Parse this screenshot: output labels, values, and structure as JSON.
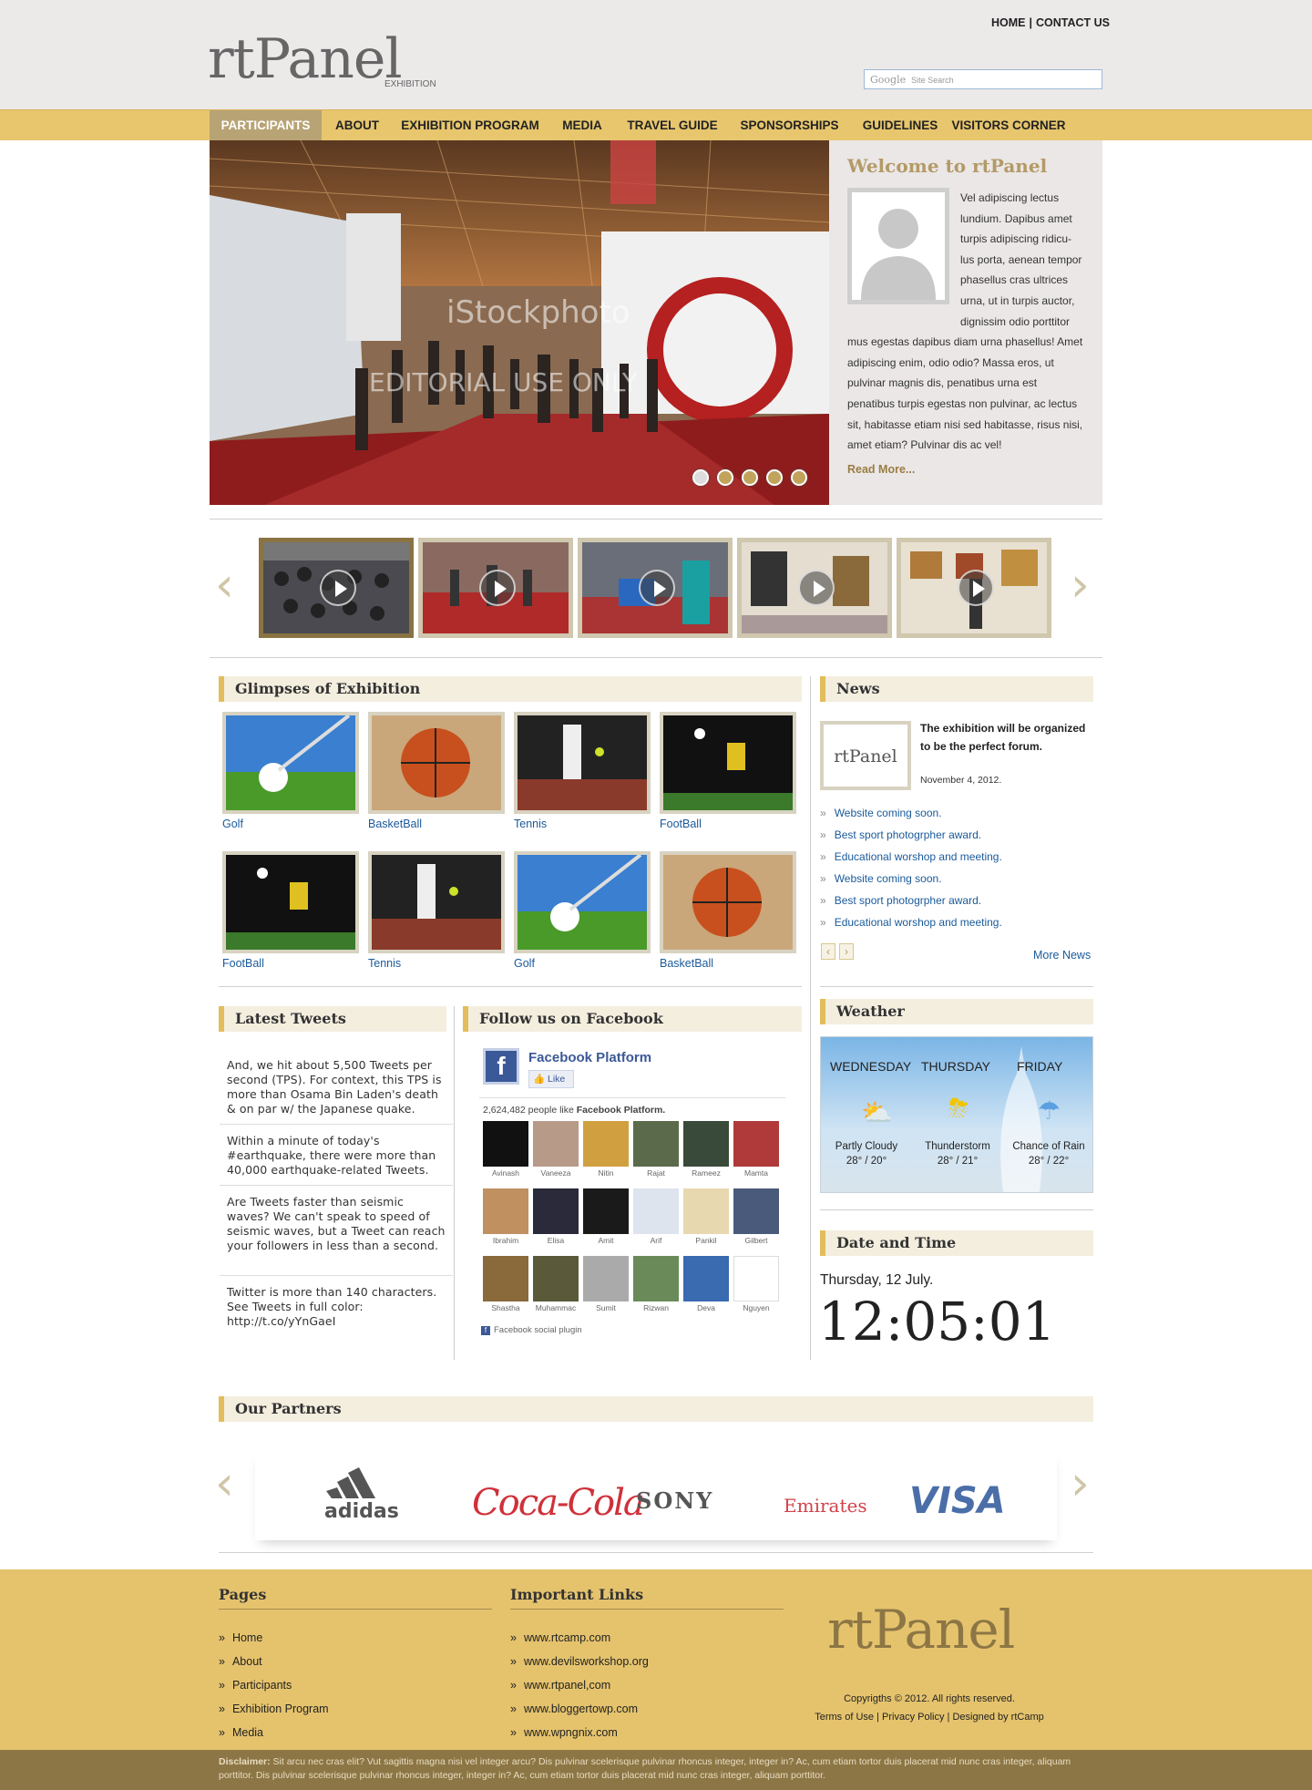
{
  "header": {
    "top_links": [
      "HOME",
      "CONTACT US"
    ],
    "logo": "rtPanel",
    "logo_sub": "EXHIBITION",
    "search_brand": "Google",
    "search_placeholder": "Site Search"
  },
  "nav": {
    "items": [
      "PARTICIPANTS",
      "ABOUT",
      "EXHIBITION PROGRAM",
      "MEDIA",
      "TRAVEL GUIDE",
      "SPONSORSHIPS",
      "GUIDELINES",
      "VISITORS CORNER"
    ],
    "active": "PARTICIPANTS"
  },
  "slider": {
    "watermark": "iStockphoto",
    "watermark2": "EDITORIAL USE ONLY",
    "dots": 5
  },
  "welcome": {
    "title": "Welcome to rtPanel",
    "text": "Vel adipiscing lectus lundium. Dapibus amet turpis adipiscing ridicu-lus porta, aenean tempor phasellus cras ultrices urna, ut in turpis auctor, dignissim odio porttitor mus egestas dapibus diam urna phasellus! Amet adipiscing enim, odio odio? Massa eros, ut pulvinar magnis dis, penatibus urna est penatibus turpis egestas non pulvinar, ac lectus sit, habitasse etiam nisi sed habitasse, risus nisi, amet etiam? Pulvinar dis ac vel!",
    "read_more": "Read More..."
  },
  "glimpses": {
    "title": "Glimpses of Exhibition",
    "items": [
      "Golf",
      "BasketBall",
      "Tennis",
      "FootBall",
      "FootBall",
      "Tennis",
      "Golf",
      "BasketBall"
    ]
  },
  "news": {
    "title": "News",
    "featured_logo": "rtPanel",
    "featured_title": "The exhibition will be organized to be the perfect forum.",
    "featured_date": "November 4, 2012.",
    "items": [
      "Website coming soon.",
      "Best sport photogrpher award.",
      "Educational worshop and meeting.",
      "Website coming soon.",
      "Best sport photogrpher award.",
      "Educational worshop and meeting."
    ],
    "more": "More News"
  },
  "tweets": {
    "title": "Latest Tweets",
    "items": [
      "And, we hit about 5,500 Tweets per second (TPS). For context, this TPS is more than Osama Bin Laden's death & on par w/ the Japanese quake.",
      "Within a minute of today's #earthquake, there were more than 40,000 earthquake-related Tweets.",
      "Are Tweets faster than seismic waves? We can't speak to speed of seismic waves, but a Tweet can reach your followers in less than a second.",
      "Twitter is more than 140 characters. See Tweets in full color: http://t.co/yYnGaeI"
    ]
  },
  "facebook": {
    "title": "Follow us on Facebook",
    "page_name": "Facebook Platform",
    "like": "Like",
    "count_text": "2,624,482 people like",
    "count_page": "Facebook Platform.",
    "people": [
      "Avinash",
      "Vaneeza",
      "Nitin",
      "Rajat",
      "Rameez",
      "Mamta",
      "Ibrahim",
      "Elisa",
      "Amit",
      "Arif",
      "Pankil",
      "Gilbert",
      "Shastha",
      "Muhammac",
      "Sumit",
      "Rizwan",
      "Deva",
      "Nguyen"
    ],
    "plugin": "Facebook social plugin"
  },
  "weather": {
    "title": "Weather",
    "days": [
      {
        "day": "WEDNESDAY",
        "cond": "Partly Cloudy",
        "temp": "28° / 20°"
      },
      {
        "day": "THURSDAY",
        "cond": "Thunderstorm",
        "temp": "28° / 21°"
      },
      {
        "day": "FRIDAY",
        "cond": "Chance of Rain",
        "temp": "28° / 22°"
      }
    ]
  },
  "datetime": {
    "title": "Date and Time",
    "date": "Thursday, 12 July.",
    "time": "12:05:01"
  },
  "partners": {
    "title": "Our Partners",
    "logos": [
      "adidas",
      "Coca-Cola",
      "SONY",
      "Emirates",
      "VISA"
    ]
  },
  "footer": {
    "pages_title": "Pages",
    "pages": [
      "Home",
      "About",
      "Participants",
      "Exhibition Program",
      "Media"
    ],
    "links_title": "Important Links",
    "links": [
      "www.rtcamp.com",
      "www.devilsworkshop.org",
      "www.rtpanel,com",
      "www.bloggertowp.com",
      "www.wpngnix.com"
    ],
    "logo": "rtPanel",
    "copyright": "Copyrigths © 2012. All rights reserved.",
    "terms": "Terms of Use",
    "privacy": "Privacy Policy",
    "designed": "Designed by rtCamp",
    "disclaimer_label": "Disclaimer:",
    "disclaimer": "Sit arcu nec cras elit? Vut sagittis magna nisi vel integer arcu? Dis pulvinar scelerisque pulvinar rhoncus integer, integer in? Ac, cum etiam tortor duis placerat mid nunc cras integer, aliquam porttitor. Dis pulvinar scelerisque pulvinar rhoncus integer, integer in? Ac, cum etiam tortor duis placerat mid nunc cras integer, aliquam porttitor."
  },
  "colors": {
    "nav_bg": "#e7c66d",
    "accent_gold": "#b39a67",
    "link_blue": "#1a5a9a",
    "footer_bg": "#e5c36d",
    "disclaimer_bg": "#8c7645"
  }
}
